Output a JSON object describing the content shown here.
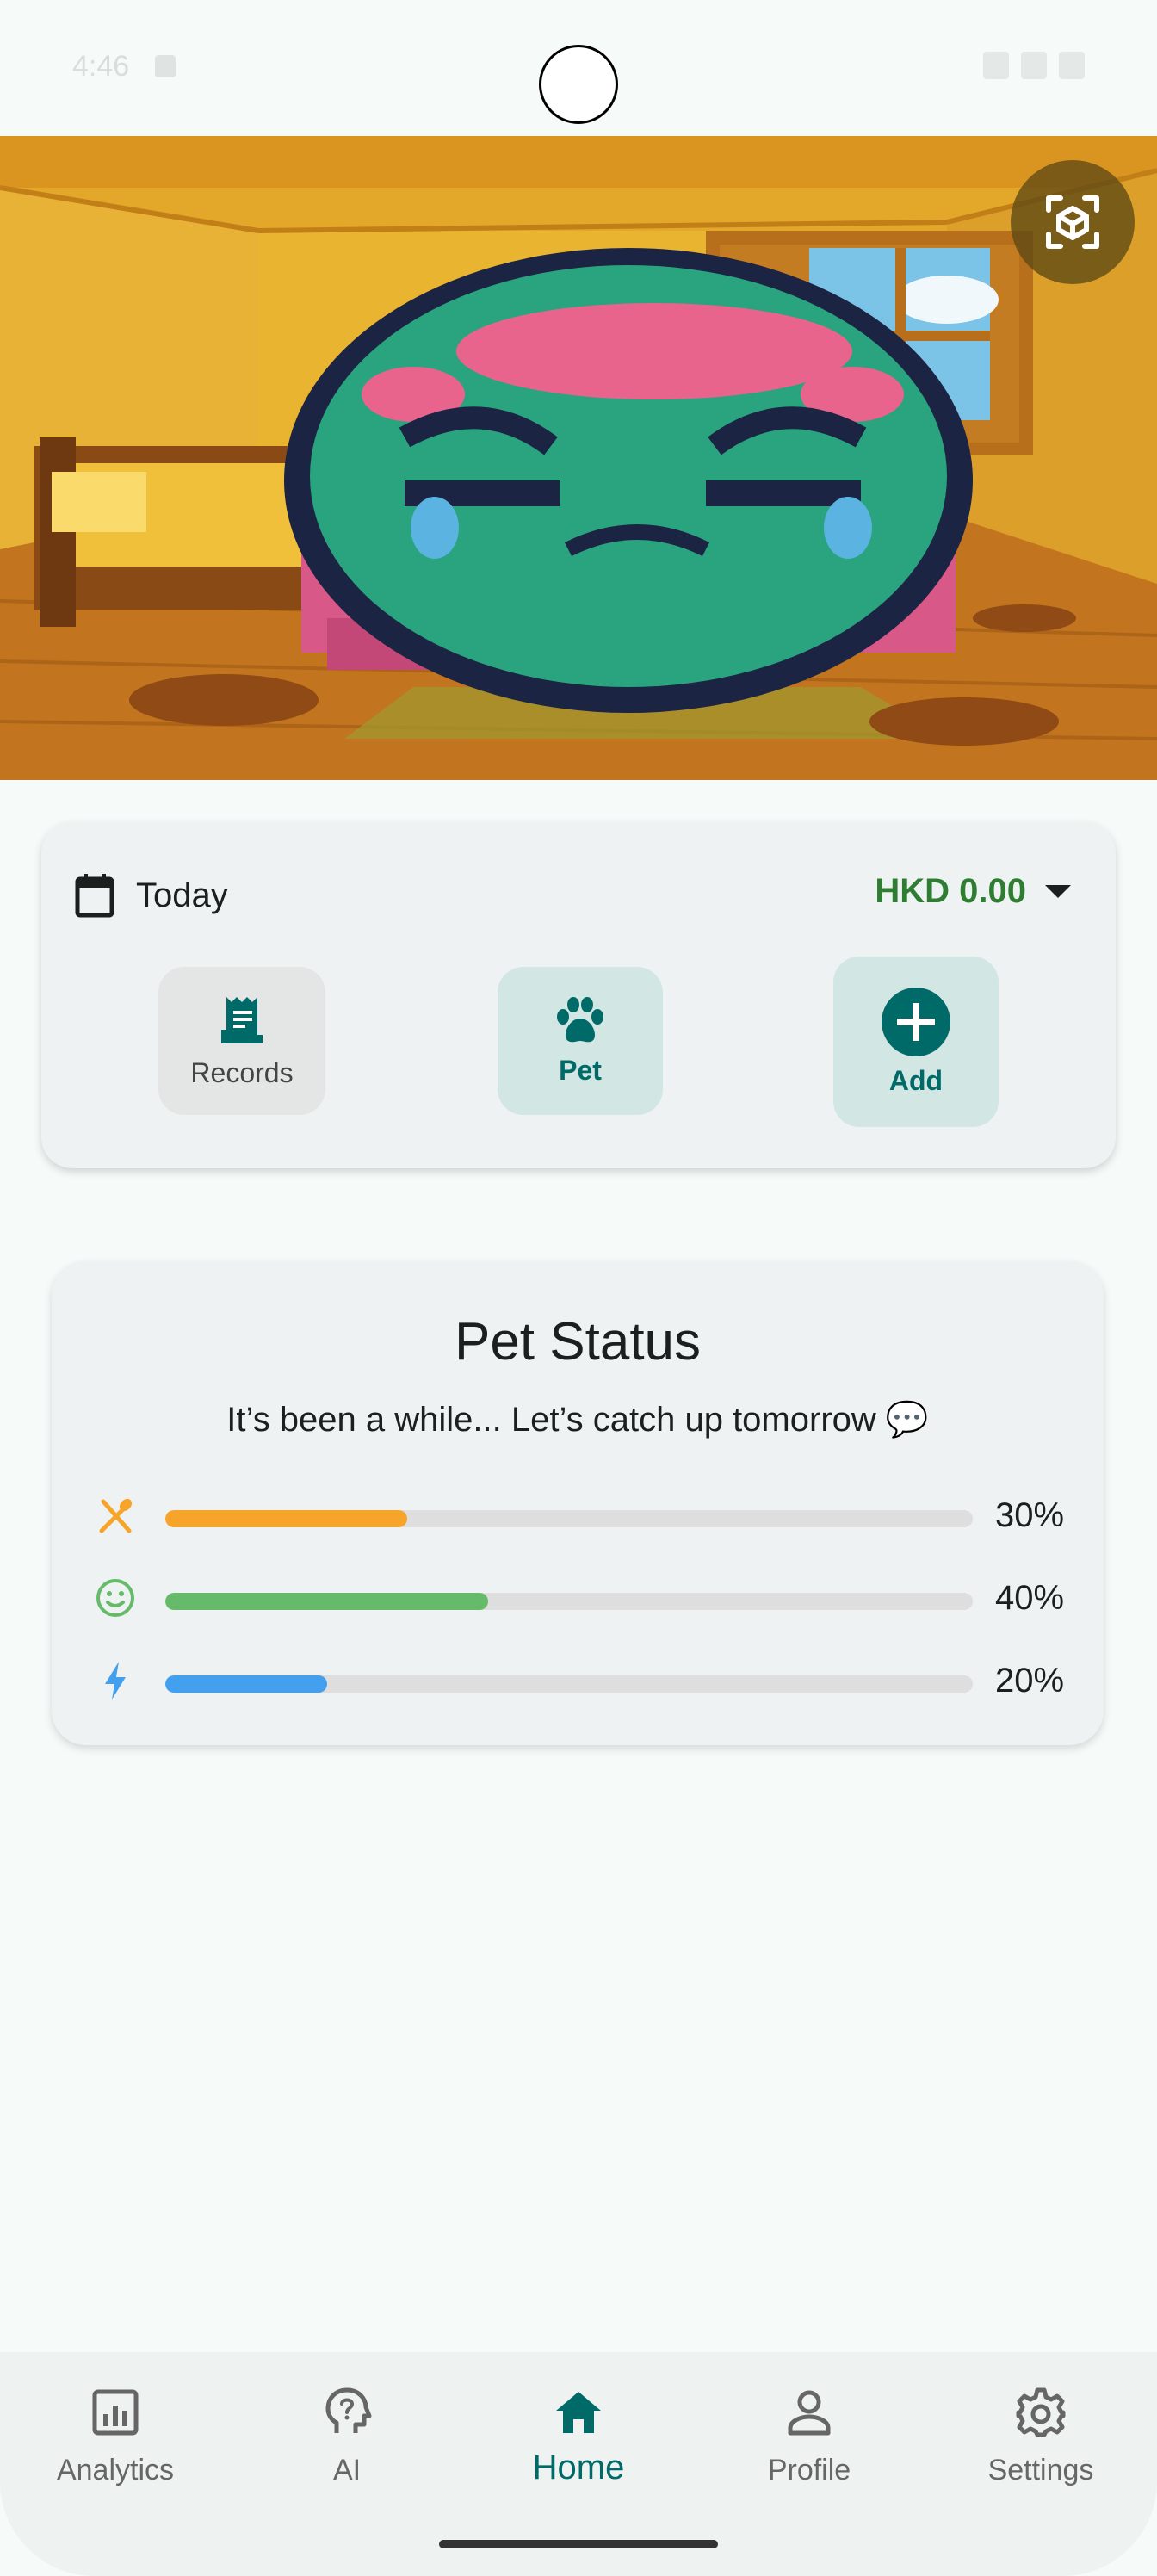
{
  "status_bar": {
    "time": "4:46"
  },
  "hero": {
    "ar_button_icon": "cube-scan-icon"
  },
  "date_card": {
    "date_label": "Today",
    "balance": "HKD 0.00",
    "actions": [
      {
        "label": "Records",
        "icon": "receipt-icon"
      },
      {
        "label": "Pet",
        "icon": "paw-icon"
      },
      {
        "label": "Add",
        "icon": "plus-circle-icon"
      }
    ]
  },
  "pet_status": {
    "title": "Pet Status",
    "message": "It’s been a while... Let’s catch up tomorrow 💬",
    "stats": [
      {
        "icon": "fork-knife-icon",
        "percent_label": "30%",
        "value": 0.3,
        "color": "#f7a42a"
      },
      {
        "icon": "smiley-icon",
        "percent_label": "40%",
        "value": 0.4,
        "color": "#66bb6a"
      },
      {
        "icon": "lightning-icon",
        "percent_label": "20%",
        "value": 0.2,
        "color": "#42a0ef"
      }
    ]
  },
  "nav": {
    "items": [
      {
        "label": "Analytics",
        "icon": "analytics-icon"
      },
      {
        "label": "AI",
        "icon": "ai-head-icon"
      },
      {
        "label": "Home",
        "icon": "home-icon",
        "active": true
      },
      {
        "label": "Profile",
        "icon": "person-icon"
      },
      {
        "label": "Settings",
        "icon": "gear-icon"
      }
    ]
  },
  "colors": {
    "accent": "#006a68",
    "balance_green": "#2e7d32"
  }
}
